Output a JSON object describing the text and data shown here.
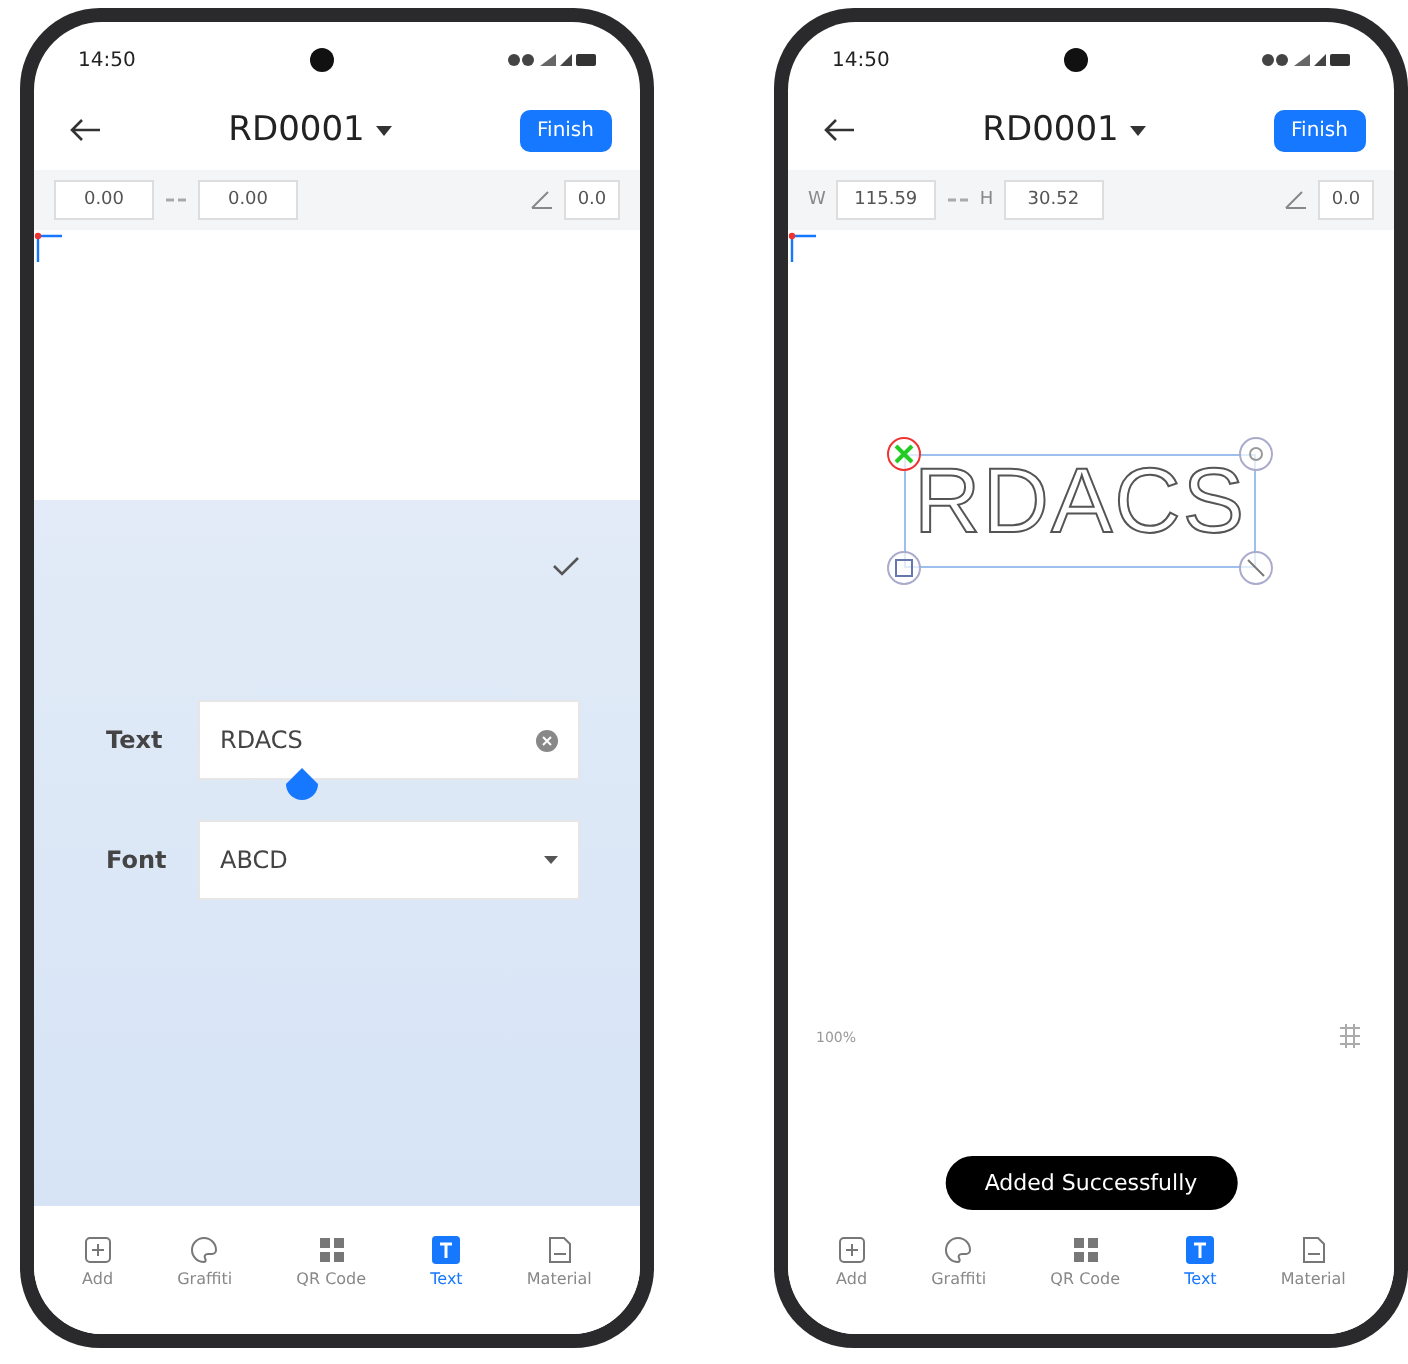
{
  "phones": [
    {
      "kind": "text_editor",
      "status_bar": {
        "time": "14:50"
      },
      "header": {
        "title": "RD0001",
        "finish": "Finish"
      },
      "dimensions": {
        "width": {
          "value": "0.00"
        },
        "height": {
          "value": "0.00"
        },
        "angle": {
          "value": "0.0"
        }
      },
      "editor": {
        "text_field": {
          "label": "Text",
          "value": "RDACS"
        },
        "font_select": {
          "label": "Font",
          "value": "ABCD"
        }
      },
      "nav": [
        {
          "label": "Add",
          "selected": false
        },
        {
          "label": "Graffiti",
          "selected": false
        },
        {
          "label": "QR Code",
          "selected": false
        },
        {
          "label": "Text",
          "selected": true
        },
        {
          "label": "Material",
          "selected": false
        }
      ]
    },
    {
      "kind": "canvas_view",
      "status_bar": {
        "time": "14:50"
      },
      "header": {
        "title": "RD0001",
        "finish": "Finish"
      },
      "dimensions": {
        "width": {
          "label": "W",
          "value": "115.59"
        },
        "height": {
          "label": "H",
          "value": "30.52"
        },
        "angle": {
          "value": "0.0"
        }
      },
      "canvas": {
        "object_text": "RDACS",
        "zoom": "100%"
      },
      "toast": "Added Successfully",
      "nav": [
        {
          "label": "Add",
          "selected": false
        },
        {
          "label": "Graffiti",
          "selected": false
        },
        {
          "label": "QR Code",
          "selected": false
        },
        {
          "label": "Text",
          "selected": true
        },
        {
          "label": "Material",
          "selected": false
        }
      ]
    }
  ]
}
